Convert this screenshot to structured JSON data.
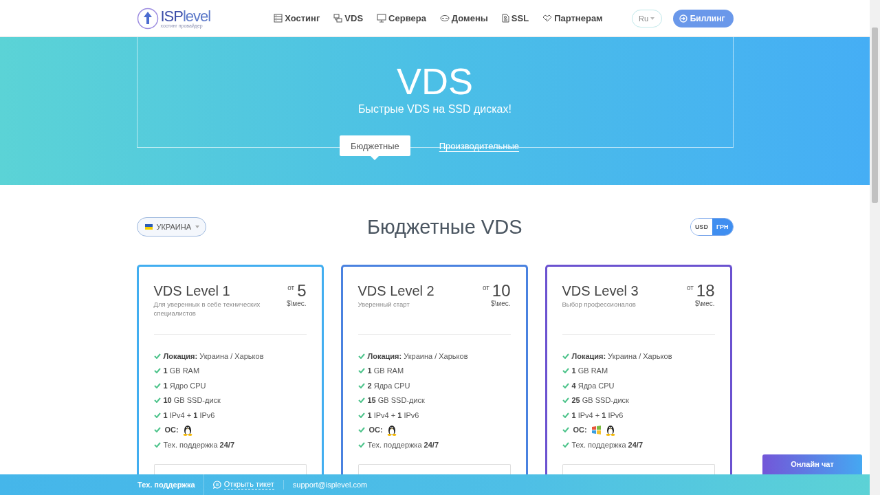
{
  "header": {
    "logo": {
      "name": "**ISP**level",
      "tagline": "хостинг провайдер"
    },
    "nav": [
      {
        "kind": "hosting",
        "label": "Хостинг"
      },
      {
        "kind": "vds",
        "label": "VDS"
      },
      {
        "kind": "server",
        "label": "Сервера"
      },
      {
        "kind": "domain",
        "label": "Домены"
      },
      {
        "kind": "ssl",
        "label": "SSL"
      },
      {
        "kind": "partner",
        "label": "Партнерам"
      }
    ],
    "language": "Ru",
    "billing": "Биллинг"
  },
  "hero": {
    "title": "VDS",
    "subtitle": "Быстрые VDS на SSD дисках!",
    "tabs": [
      {
        "label": "Бюджетные",
        "selected": true
      },
      {
        "label": "Производительные",
        "selected": false
      }
    ]
  },
  "section": {
    "country": "УКРАИНА",
    "title": "Бюджетные VDS",
    "currency": [
      {
        "label": "USD",
        "selected": false
      },
      {
        "label": "ГРН",
        "selected": true
      }
    ]
  },
  "plans": [
    {
      "name": "VDS Level 1",
      "subtitle": "Для уверенных в себе технических специалистов",
      "from": "от",
      "price": "5",
      "unit": "$\\мес.",
      "color": "#42aef0",
      "features": [
        {
          "kind": "text",
          "text": "**Локация:** Украина / Харьков"
        },
        {
          "kind": "text",
          "text": "**1** GB RAM"
        },
        {
          "kind": "text",
          "text": "**1** Ядро CPU"
        },
        {
          "kind": "text",
          "text": "**10** GB SSD-диск"
        },
        {
          "kind": "text",
          "text": "**1** IPv4 + **1** IPv6"
        },
        {
          "kind": "os",
          "text": "ОС:",
          "os": [
            {
              "kind": "linux"
            }
          ]
        },
        {
          "kind": "text",
          "text": "Тех. поддержка **24/7**"
        }
      ]
    },
    {
      "name": "VDS Level 2",
      "subtitle": "Уверенный старт",
      "from": "от",
      "price": "10",
      "unit": "$\\мес.",
      "color": "#4a82e0",
      "features": [
        {
          "kind": "text",
          "text": "**Локация:** Украина / Харьков"
        },
        {
          "kind": "text",
          "text": "**1** GB RAM"
        },
        {
          "kind": "text",
          "text": "**2** Ядра CPU"
        },
        {
          "kind": "text",
          "text": "**15** GB SSD-диск"
        },
        {
          "kind": "text",
          "text": "**1** IPv4 + **1** IPv6"
        },
        {
          "kind": "os",
          "text": "ОС:",
          "os": [
            {
              "kind": "linux"
            }
          ]
        },
        {
          "kind": "text",
          "text": "Тех. поддержка **24/7**"
        }
      ]
    },
    {
      "name": "VDS Level 3",
      "subtitle": "Выбор профессионалов",
      "from": "от",
      "price": "18",
      "unit": "$\\мес.",
      "color": "#6b52d0",
      "features": [
        {
          "kind": "text",
          "text": "**Локация:** Украина / Харьков"
        },
        {
          "kind": "text",
          "text": "**1** GB RAM"
        },
        {
          "kind": "text",
          "text": "**4** Ядра CPU"
        },
        {
          "kind": "text",
          "text": "**25** GB SSD-диск"
        },
        {
          "kind": "text",
          "text": "**1** IPv4 + **1** IPv6"
        },
        {
          "kind": "os",
          "text": "ОС:",
          "os": [
            {
              "kind": "windows"
            },
            {
              "kind": "linux"
            }
          ]
        },
        {
          "kind": "text",
          "text": "Тех. поддержка **24/7**"
        }
      ]
    }
  ],
  "chat": "Онлайн чат",
  "footer": {
    "label": "Тех. поддержка",
    "ticket": "Открыть тикет",
    "email": "support@isplevel.com"
  }
}
